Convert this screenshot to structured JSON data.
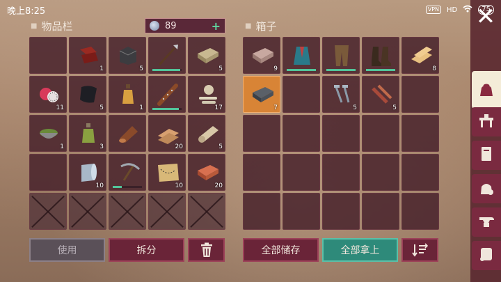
{
  "status": {
    "time": "晚上8:25",
    "vpn": "VPN",
    "network": "HD",
    "battery": "75"
  },
  "inventory": {
    "title": "物品栏",
    "currency": {
      "value": "89",
      "plus": "+"
    },
    "cells": [
      {
        "icon": "empty-slot",
        "count": "",
        "dur": null
      },
      {
        "icon": "leather-scraps-icon",
        "count": "1",
        "dur": null
      },
      {
        "icon": "stone-block-icon",
        "count": "5",
        "dur": null
      },
      {
        "icon": "spear-icon",
        "count": "",
        "dur": 0.95
      },
      {
        "icon": "clay-brick-icon",
        "count": "5",
        "dur": null
      },
      {
        "icon": "dragon-fruit-icon",
        "count": "11",
        "dur": null
      },
      {
        "icon": "leather-sheet-icon",
        "count": "5",
        "dur": null
      },
      {
        "icon": "potion-bottle-icon",
        "count": "1",
        "dur": null
      },
      {
        "icon": "spiked-club-icon",
        "count": "",
        "dur": 0.9
      },
      {
        "icon": "bone-pile-icon",
        "count": "17",
        "dur": null
      },
      {
        "icon": "herbal-bowl-icon",
        "count": "1",
        "dur": null
      },
      {
        "icon": "green-flask-icon",
        "count": "3",
        "dur": null
      },
      {
        "icon": "wood-log-icon",
        "count": "",
        "dur": null
      },
      {
        "icon": "planks-icon",
        "count": "20",
        "dur": null
      },
      {
        "icon": "cloth-roll-icon",
        "count": "5",
        "dur": null
      },
      {
        "icon": "empty-slot",
        "count": "",
        "dur": null
      },
      {
        "icon": "metal-sheet-icon",
        "count": "10",
        "dur": null
      },
      {
        "icon": "pickaxe-icon",
        "count": "",
        "dur": 0.3
      },
      {
        "icon": "treasure-map-icon",
        "count": "10",
        "dur": null
      },
      {
        "icon": "red-brick-icon",
        "count": "20",
        "dur": null
      },
      {
        "icon": "locked-slot",
        "count": "",
        "dur": null
      },
      {
        "icon": "locked-slot",
        "count": "",
        "dur": null
      },
      {
        "icon": "locked-slot",
        "count": "",
        "dur": null
      },
      {
        "icon": "locked-slot",
        "count": "",
        "dur": null
      },
      {
        "icon": "locked-slot",
        "count": "",
        "dur": null
      }
    ],
    "buttons": {
      "use": "使用",
      "split": "拆分"
    }
  },
  "chest": {
    "title": "箱子",
    "cells": [
      {
        "icon": "iron-ingot-icon",
        "count": "9",
        "dur": null,
        "selected": false
      },
      {
        "icon": "vest-icon",
        "count": "",
        "dur": 1,
        "selected": false
      },
      {
        "icon": "leather-pants-icon",
        "count": "",
        "dur": 1,
        "selected": false
      },
      {
        "icon": "boots-icon",
        "count": "",
        "dur": 1,
        "selected": false
      },
      {
        "icon": "wood-planks-icon",
        "count": "8",
        "dur": null,
        "selected": false
      },
      {
        "icon": "steel-ingot-icon",
        "count": "7",
        "dur": null,
        "selected": true
      },
      {
        "icon": "empty-slot",
        "count": "",
        "dur": null,
        "selected": false
      },
      {
        "icon": "nails-icon",
        "count": "5",
        "dur": null,
        "selected": false
      },
      {
        "icon": "wooden-parts-icon",
        "count": "5",
        "dur": null,
        "selected": false
      },
      {
        "icon": "empty-slot",
        "count": "",
        "dur": null,
        "selected": false
      },
      {
        "icon": "empty-slot",
        "count": "",
        "dur": null,
        "selected": false
      },
      {
        "icon": "empty-slot",
        "count": "",
        "dur": null,
        "selected": false
      },
      {
        "icon": "empty-slot",
        "count": "",
        "dur": null,
        "selected": false
      },
      {
        "icon": "empty-slot",
        "count": "",
        "dur": null,
        "selected": false
      },
      {
        "icon": "empty-slot",
        "count": "",
        "dur": null,
        "selected": false
      },
      {
        "icon": "empty-slot",
        "count": "",
        "dur": null,
        "selected": false
      },
      {
        "icon": "empty-slot",
        "count": "",
        "dur": null,
        "selected": false
      },
      {
        "icon": "empty-slot",
        "count": "",
        "dur": null,
        "selected": false
      },
      {
        "icon": "empty-slot",
        "count": "",
        "dur": null,
        "selected": false
      },
      {
        "icon": "empty-slot",
        "count": "",
        "dur": null,
        "selected": false
      },
      {
        "icon": "empty-slot",
        "count": "",
        "dur": null,
        "selected": false
      },
      {
        "icon": "empty-slot",
        "count": "",
        "dur": null,
        "selected": false
      },
      {
        "icon": "empty-slot",
        "count": "",
        "dur": null,
        "selected": false
      },
      {
        "icon": "empty-slot",
        "count": "",
        "dur": null,
        "selected": false
      },
      {
        "icon": "empty-slot",
        "count": "",
        "dur": null,
        "selected": false
      }
    ],
    "buttons": {
      "store_all": "全部储存",
      "take_all": "全部拿上"
    }
  },
  "sidebar": {
    "tabs": [
      "bag-icon",
      "workbench-icon",
      "book-icon",
      "loot-sack-icon",
      "anvil-icon",
      "scroll-icon"
    ]
  },
  "colors": {
    "accent": "#6a2438",
    "teal": "#2e8a7a",
    "selected": "#d88436",
    "durability": "#52c49a"
  }
}
